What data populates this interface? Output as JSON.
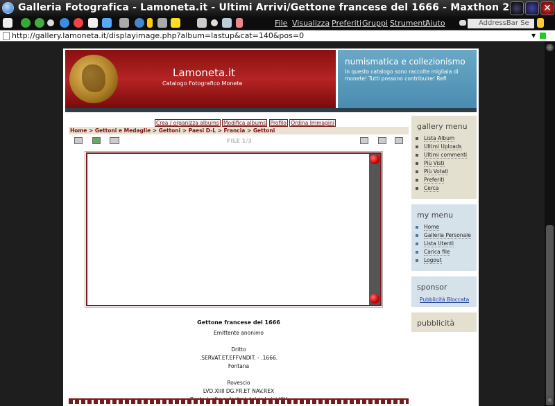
{
  "window": {
    "title": "Galleria Fotografica - Lamoneta.it - Ultimi Arrivi/Gettone francese del 1666 - Maxthon 2...."
  },
  "menubar": {
    "items": [
      "File",
      "Visualizza",
      "Preferiti",
      "Gruppi",
      "Strumenti",
      "Aiuto"
    ],
    "address_placeholder": "AddressBar Se"
  },
  "urlbar": {
    "url": "http://gallery.lamoneta.it/displayimage.php?album=lastup&cat=140&pos=0"
  },
  "header": {
    "site_name": "Lamoneta.it",
    "subtitle": "Catalogo Fotografico Monete",
    "right_title": "numismatica e collezionismo",
    "right_text": "In questo catalogo sono raccolte migliaia di monete! Tutti possono contribuire! Refi"
  },
  "tabs": [
    "Crea / organizza albums",
    "Modifica albums",
    "Profilo",
    "Ordina Immagini"
  ],
  "breadcrumb": "Home > Gettoni e Medaglie > Gettoni > Paesi D-L > Francia > Gettoni",
  "file_counter": "FILE 1/3",
  "image_info": {
    "title": "Gettone francese del 1666",
    "issuer": "Emittente anonimo",
    "obverse_label": "Dritto",
    "obverse_legend": ".SERVAT.ET.EFFVNDIT. - .1666.",
    "obverse_type": "Fontana",
    "reverse_label": "Rovescio",
    "reverse_legend": "LVD.XIIII DG.FR.ET NAV.REX",
    "reverse_type": "Busto (volto a destra) del re Luigi XIV"
  },
  "sidebar": {
    "gallery_menu": {
      "title": "gallery menu",
      "items": [
        "Lista Album",
        "Ultimi Uploads",
        "Ultimi commenti",
        "Più Visti",
        "Più Votati",
        "Preferiti",
        "Cerca"
      ]
    },
    "my_menu": {
      "title": "my menu",
      "items": [
        "Home",
        "Galleria Personale",
        "Lista Utenti",
        "Carica file",
        "Logout"
      ]
    },
    "sponsor": {
      "title": "sponsor",
      "link": "Pubblicità Bloccata"
    },
    "pubblicita": {
      "title": "pubblicità"
    }
  },
  "colors": {
    "accent": "#7a1a1a",
    "banner_blue": "#4a8cb0"
  }
}
